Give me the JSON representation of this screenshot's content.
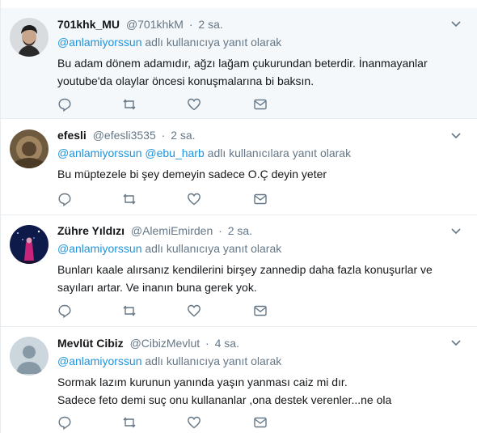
{
  "tweets": [
    {
      "name": "701khk_MU",
      "handle": "@701khkM",
      "sep": "·",
      "time": "2 sa.",
      "reply_mentions": [
        "@anlamiyorssun"
      ],
      "reply_suffix": "adlı kullanıcıya yanıt olarak",
      "lines": [
        "Bu adam dönem adamıdır, ağzı lağam çukurundan beterdir. İnanmayanlar",
        "youtube'da olaylar öncesi konuşmalarına bi baksın."
      ],
      "highlighted": true,
      "avatar": "dark-haired-man-avatar"
    },
    {
      "name": "efesli",
      "handle": "@efesli3535",
      "sep": "·",
      "time": "2 sa.",
      "reply_mentions": [
        "@anlamiyorssun",
        "@ebu_harb"
      ],
      "reply_suffix": "adlı kullanıcılara yanıt olarak",
      "lines": [
        "Bu müptezele bi şey demeyin sadece O.Ç deyin yeter"
      ],
      "highlighted": false,
      "avatar": "sepia-photo-avatar"
    },
    {
      "name": "Zühre Yıldızı",
      "handle": "@AlemiEmirden",
      "sep": "·",
      "time": "2 sa.",
      "reply_mentions": [
        "@anlamiyorssun"
      ],
      "reply_suffix": "adlı kullanıcıya yanıt olarak",
      "lines": [
        "Bunları  kaale alırsanız kendilerini birşey zannedip daha fazla konuşurlar ve",
        "sayıları artar. Ve inanın buna gerek yok."
      ],
      "highlighted": false,
      "avatar": "night-sky-avatar"
    },
    {
      "name": "Mevlüt Cibiz",
      "handle": "@CibizMevlut",
      "sep": "·",
      "time": "4 sa.",
      "reply_mentions": [
        "@anlamiyorssun"
      ],
      "reply_suffix": "adlı kullanıcıya yanıt olarak",
      "lines": [
        "Sormak lazım kurunun yanında yaşın yanması caiz mi dır.",
        "Sadece feto demi suç onu kullananlar ,ona destek verenler...ne ola"
      ],
      "highlighted": false,
      "avatar": "default-profile-avatar"
    }
  ],
  "colors": {
    "link": "#1b95e0",
    "secondary_text": "#657786",
    "primary_text": "#14171a",
    "highlight_bg": "#f5f8fa",
    "border": "#e6ecf0"
  },
  "icons": [
    "chevron-down-icon",
    "reply-icon",
    "retweet-icon",
    "like-icon",
    "direct-message-icon"
  ]
}
